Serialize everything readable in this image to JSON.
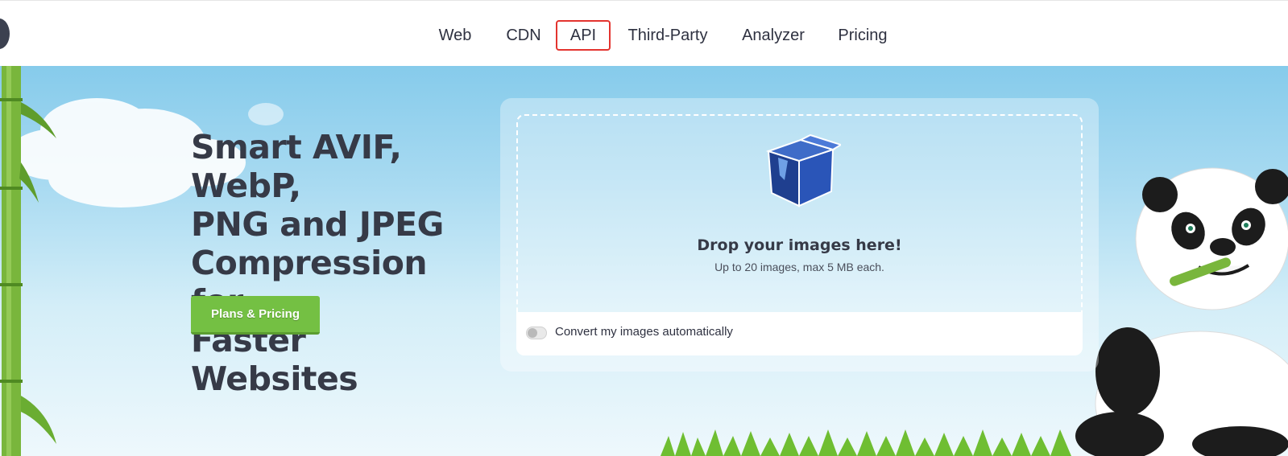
{
  "nav": {
    "items": [
      {
        "label": "Web"
      },
      {
        "label": "CDN"
      },
      {
        "label": "API",
        "highlighted": true
      },
      {
        "label": "Third-Party"
      },
      {
        "label": "Analyzer"
      },
      {
        "label": "Pricing"
      }
    ]
  },
  "hero": {
    "headline_lines": [
      "Smart AVIF, WebP,",
      "PNG and JPEG",
      "Compression for",
      "Faster Websites"
    ],
    "cta_label": "Plans & Pricing"
  },
  "upload": {
    "title": "Drop your images here!",
    "subtitle": "Up to 20 images, max 5 MB each.",
    "convert_label": "Convert my images automatically",
    "convert_enabled": false
  },
  "colors": {
    "highlight_border": "#e3342f",
    "cta_green": "#74c043",
    "headline_text": "#363a47"
  },
  "icons": [
    "box-icon",
    "panda-illustration",
    "bamboo-illustration"
  ]
}
